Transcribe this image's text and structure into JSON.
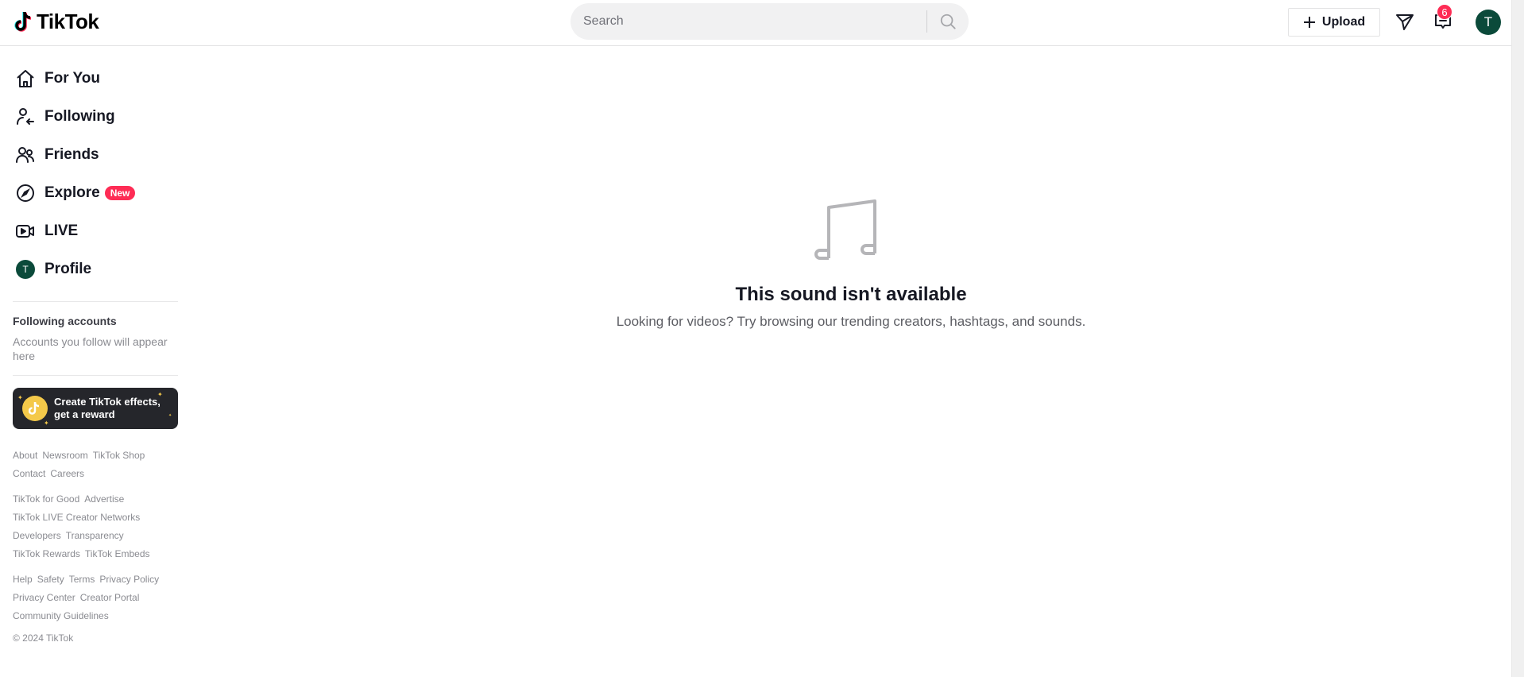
{
  "header": {
    "logo_text": "TikTok",
    "search": {
      "placeholder": "Search",
      "value": ""
    },
    "upload_label": "Upload",
    "inbox_badge": "6",
    "avatar_initial": "T"
  },
  "sidebar": {
    "nav": [
      {
        "label": "For You",
        "icon": "home-icon"
      },
      {
        "label": "Following",
        "icon": "following-icon"
      },
      {
        "label": "Friends",
        "icon": "friends-icon"
      },
      {
        "label": "Explore",
        "icon": "compass-icon",
        "badge": "New"
      },
      {
        "label": "LIVE",
        "icon": "live-camera-icon"
      },
      {
        "label": "Profile",
        "icon": "avatar",
        "initial": "T"
      }
    ],
    "following_accounts": {
      "title": "Following accounts",
      "empty_text": "Accounts you follow will appear here"
    },
    "effects_card": {
      "line1": "Create TikTok effects,",
      "line2": "get a reward"
    },
    "footer": {
      "group1": [
        [
          "About",
          "Newsroom",
          "TikTok Shop"
        ],
        [
          "Contact",
          "Careers"
        ]
      ],
      "group2": [
        [
          "TikTok for Good",
          "Advertise"
        ],
        [
          "TikTok LIVE Creator Networks"
        ],
        [
          "Developers",
          "Transparency"
        ],
        [
          "TikTok Rewards",
          "TikTok Embeds"
        ]
      ],
      "group3": [
        [
          "Help",
          "Safety",
          "Terms",
          "Privacy Policy"
        ],
        [
          "Privacy Center",
          "Creator Portal"
        ],
        [
          "Community Guidelines"
        ]
      ],
      "copyright": "© 2024 TikTok"
    }
  },
  "main": {
    "empty_state": {
      "icon": "music-note-icon",
      "title": "This sound isn't available",
      "description": "Looking for videos? Try browsing our trending creators, hashtags, and sounds."
    }
  },
  "colors": {
    "brand_red": "#fe2c55",
    "avatar_green": "#0b4a3a",
    "effects_gold": "#f4c94a"
  }
}
